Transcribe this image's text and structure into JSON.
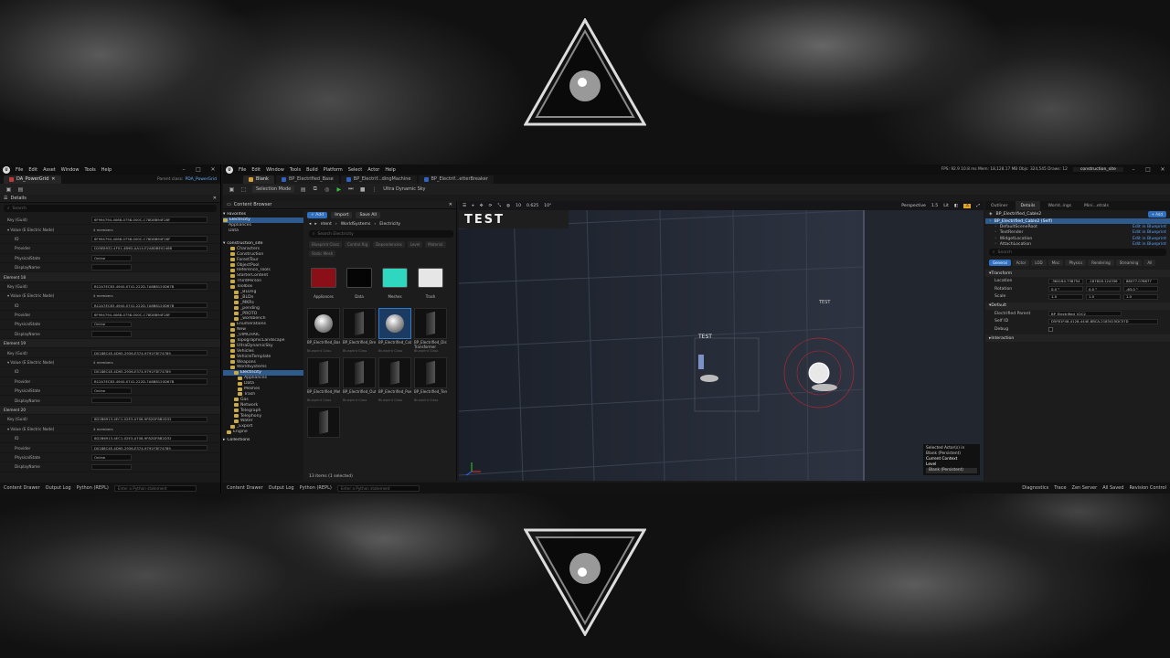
{
  "colors": {
    "accent": "#2f7ad1",
    "selection": "#2e5a8e",
    "link": "#5ba3ff",
    "play": "#3cc13c"
  },
  "left_window": {
    "menu": [
      "File",
      "Edit",
      "Asset",
      "Window",
      "Tools",
      "Help"
    ],
    "tab": "DA_PowerGrid",
    "parent_class_label": "Parent class:",
    "parent_class": "PDA_PowerGrid",
    "panel_title": "Details",
    "search_placeholder": "Search",
    "rows": [
      {
        "name": "Key (Guid)",
        "value": "6F994794-4068-0758-000C-C78D8B94F28F",
        "kind": "field"
      },
      {
        "name": "▾ Value (E Electric Node)",
        "value": "4 members",
        "kind": "none"
      },
      {
        "name": "ID",
        "value": "6F994794-4068-0758-000C-C78D8B94F28F",
        "kind": "field"
      },
      {
        "name": "Provider",
        "value": "D28E8932-4F01-4B9D-AA14-E2A8DBE0246B",
        "kind": "field"
      },
      {
        "name": "PhysicalState",
        "value": "Online",
        "kind": "short"
      },
      {
        "name": "DisplayName",
        "value": "",
        "kind": "short"
      },
      {
        "name": "Element 18",
        "value": "",
        "kind": "elem"
      },
      {
        "name": "Key (Guid)",
        "value": "B12A7EC83-4940-0741-222D-7A8B8120D67B",
        "kind": "field"
      },
      {
        "name": "▾ Value (E Electric Node)",
        "value": "4 members",
        "kind": "none"
      },
      {
        "name": "ID",
        "value": "B12A7EC83-4940-0741-222D-7A8B8120D67B",
        "kind": "field"
      },
      {
        "name": "Provider",
        "value": "6F994794-4068-0758-000C-C78D8B94F28F",
        "kind": "field"
      },
      {
        "name": "PhysicalState",
        "value": "Online",
        "kind": "short"
      },
      {
        "name": "DisplayName",
        "value": "",
        "kind": "short"
      },
      {
        "name": "Element 19",
        "value": "",
        "kind": "elem"
      },
      {
        "name": "Key (Guid)",
        "value": "D0188C4E-4D95-2936-E374-9791F3E74789",
        "kind": "field"
      },
      {
        "name": "▾ Value (E Electric Node)",
        "value": "4 members",
        "kind": "none"
      },
      {
        "name": "ID",
        "value": "D0188C4E-4D95-2936-E374-9791F3E74789",
        "kind": "field"
      },
      {
        "name": "Provider",
        "value": "B12A7EC83-4940-0741-222D-7A8B8120D67B",
        "kind": "field"
      },
      {
        "name": "PhysicalState",
        "value": "Online",
        "kind": "short"
      },
      {
        "name": "DisplayName",
        "value": "",
        "kind": "short"
      },
      {
        "name": "Element 20",
        "value": "",
        "kind": "elem"
      },
      {
        "name": "Key (Guid)",
        "value": "8D2B6913-4EC1-02E3-A708-9F82DF8B2D32",
        "kind": "field"
      },
      {
        "name": "▾ Value (E Electric Node)",
        "value": "4 members",
        "kind": "none"
      },
      {
        "name": "ID",
        "value": "8D2B6913-4EC1-02E3-A708-9F82DF8B2D32",
        "kind": "field"
      },
      {
        "name": "Provider",
        "value": "D0188C4E-4D95-2936-E374-9791F3E74789",
        "kind": "field"
      },
      {
        "name": "PhysicalState",
        "value": "Online",
        "kind": "short"
      },
      {
        "name": "DisplayName",
        "value": "",
        "kind": "short"
      }
    ]
  },
  "main_window": {
    "menu": [
      "File",
      "Edit",
      "Window",
      "Tools",
      "Build",
      "Platform",
      "Select",
      "Actor",
      "Help"
    ],
    "tabs": [
      "Blank",
      "BP_Electrified_Base",
      "BP_Electrif...dingMachine",
      "BP_Electrif...etterBreaker"
    ],
    "stats": "FPS: 92.9   10.8 ms   Mem: 18,128.17 MB   Objs: 324,545   Draws: 12",
    "project": "construction_site",
    "toolbar": {
      "mode": "Selection Mode",
      "platform": "Ultra Dynamic Sky"
    },
    "viewport_bar": {
      "perspective": "Perspective",
      "lit": "Lit",
      "grid": "10",
      "angle": "10°",
      "scale": "0.625",
      "cam": "1.5"
    },
    "viewport_text": {
      "wall_sign": "TEST",
      "small_sign": "TEST",
      "tag": "TEST"
    },
    "viewport_info": {
      "line1": "Selected Actor(s) in",
      "line2": "Blank (Persistent)",
      "current_context": "Current Context",
      "level": "Level",
      "level_value": "Blank (Persistent)"
    }
  },
  "content_browser": {
    "title": "Content Browser",
    "add": "+ Add",
    "import": "Import",
    "save_all": "Save All",
    "favorites": "Favorites",
    "favorites_items": [
      "Electricity",
      "Appliances",
      "Data"
    ],
    "root": "construction_site",
    "tree": [
      "Characters",
      "Construction",
      "ForestTour",
      "ObjectPool",
      "Reference_Tools",
      "StarterContent",
      "ThirdPerson",
      "Toolbox",
      "_BLDng",
      "_BLDn",
      "_MKRs",
      "_pending",
      "_PROTO",
      "_workbench",
      "Enumerations",
      "New",
      "_UIMCHAIC",
      "TopographicLandscape",
      "UltraDynamicSky",
      "Vehicles",
      "VehicleTemplate",
      "Weapons",
      "WorldSystems",
      "Electricity",
      "Appliances",
      "Data",
      "Meshes",
      "Trash",
      "Gas",
      "Network",
      "Telegraph",
      "Telephony",
      "Water",
      "_Export",
      "Engine"
    ],
    "collections": "Collections",
    "crumbs": [
      "ntent",
      "WorldSystems",
      "Electricity"
    ],
    "search_placeholder": "Search Electricity",
    "filters": [
      "Blueprint Class",
      "Control Rig",
      "Dependencies",
      "Level",
      "Material",
      "Static Mesh"
    ],
    "folders": [
      {
        "name": "Appliances",
        "color": "#8a0f17"
      },
      {
        "name": "Data",
        "color": "#050505"
      },
      {
        "name": "Meshes",
        "color": "#2fd6c0"
      },
      {
        "name": "Trash",
        "color": "#e6e6e6"
      }
    ],
    "assets": [
      {
        "name": "BP_Electrified_Base",
        "type": "Blueprint Class",
        "thumb": "sphere",
        "selected": false
      },
      {
        "name": "BP_Electrified_BreakerBox",
        "type": "Blueprint Class",
        "thumb": "slab",
        "selected": false
      },
      {
        "name": "BP_Electrified_Cable",
        "type": "Blueprint Class",
        "thumb": "sphere",
        "selected": true
      },
      {
        "name": "BP_Electrified_Distribution Transformer",
        "type": "Blueprint Class",
        "thumb": "slab",
        "selected": false
      },
      {
        "name": "BP_Electrified_MeterBreaker",
        "type": "Blueprint Class",
        "thumb": "slab",
        "selected": false
      },
      {
        "name": "BP_Electrified_Outlet",
        "type": "Blueprint Class",
        "thumb": "slab",
        "selected": false
      },
      {
        "name": "BP_Electrified_PowerPlant",
        "type": "Blueprint Class",
        "thumb": "slab",
        "selected": false
      },
      {
        "name": "BP_Electrified_Terminal",
        "type": "Blueprint Class",
        "thumb": "slab",
        "selected": false
      },
      {
        "name": "",
        "type": "",
        "thumb": "slab",
        "selected": false
      }
    ],
    "status": "13 items (1 selected)"
  },
  "right_panel": {
    "tabs": [
      "Outliner",
      "Details",
      "World..ings",
      "Mini...etrals"
    ],
    "actor": "BP_Electrified_Cable2",
    "add_label": "+ Add",
    "components": [
      {
        "name": "BP_Electrified_Cable2 (Self)",
        "link": ""
      },
      {
        "name": "DefaultSceneRoot",
        "link": "Edit in Blueprint"
      },
      {
        "name": "TextRender",
        "link": "Edit in Blueprint"
      },
      {
        "name": "WidgetLocation",
        "link": "Edit in Blueprint"
      },
      {
        "name": "AttachLocation",
        "link": "Edit in Blueprint"
      }
    ],
    "search_placeholder": "Search",
    "subtabs": [
      "General",
      "Actor",
      "LOD",
      "Misc",
      "Physics",
      "Rendering",
      "Streaming",
      "All"
    ],
    "transform": "Transform",
    "location": {
      "label": "Location",
      "x": "-364164.738754",
      "y": "-187828.124336",
      "z": "88077.078677"
    },
    "rotation": {
      "label": "Rotation",
      "x": "0.0 °",
      "y": "0.0 °",
      "z": "-63.0 °"
    },
    "scale": {
      "label": "Scale",
      "x": "1.0",
      "y": "1.0",
      "z": "1.0"
    },
    "default_section": "Default",
    "electrified_parent": {
      "label": "Electrified Parent",
      "value": "BP_Electrified_V2C2"
    },
    "self_id": {
      "label": "Self ID",
      "value": "D5F81F48-4128-444E-8BCA-2183415DC57D"
    },
    "debug": {
      "label": "Debug"
    },
    "interaction": "Interaction"
  },
  "statusbar_left": {
    "drawer": "Content Drawer",
    "log": "Output Log",
    "python": "Python (REPL)",
    "placeholder": "Enter a Python statement"
  },
  "statusbar_main": {
    "drawer": "Content Drawer",
    "log": "Output Log",
    "python": "Python (REPL)",
    "placeholder": "Enter a Python statement",
    "diag": "Diagnostics",
    "trace": "Trace",
    "zen": "Zen Server",
    "saved": "All Saved",
    "rev": "Revision Control"
  }
}
